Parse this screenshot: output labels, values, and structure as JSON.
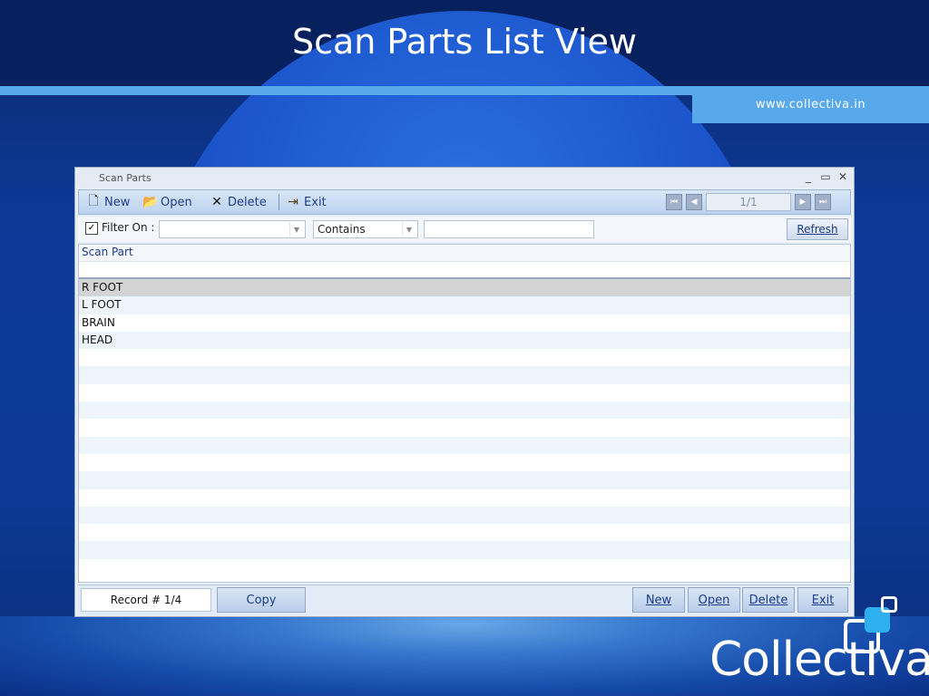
{
  "slide": {
    "title": "Scan Parts List View",
    "url": "www.collectiva.in",
    "logo_text": "CollectIva"
  },
  "window": {
    "title": "Scan Parts",
    "controls": {
      "minimize": "_",
      "maximize": "▭",
      "close": "✕"
    }
  },
  "toolbar": {
    "new_label": "New",
    "open_label": "Open",
    "delete_label": "Delete",
    "exit_label": "Exit",
    "page_indicator": "1/1"
  },
  "filter": {
    "checked": true,
    "label": "Filter On :",
    "field_value": "",
    "operator_value": "Contains",
    "text_value": "",
    "refresh_label": "Refresh"
  },
  "grid": {
    "column_header": "Scan Part",
    "rows": [
      "R FOOT",
      "L FOOT",
      "BRAIN",
      "HEAD"
    ],
    "selected_index": 0
  },
  "footer": {
    "record_label": "Record # 1/4",
    "copy_label": "Copy",
    "new_label": "New",
    "open_label": "Open",
    "delete_label": "Delete",
    "exit_label": "Exit"
  },
  "colors": {
    "background_dark": "#0a2a6e",
    "accent_bar": "#58a8ec",
    "toolbar_text": "#1e3d8a",
    "logo_square": "#2fb0ee"
  }
}
